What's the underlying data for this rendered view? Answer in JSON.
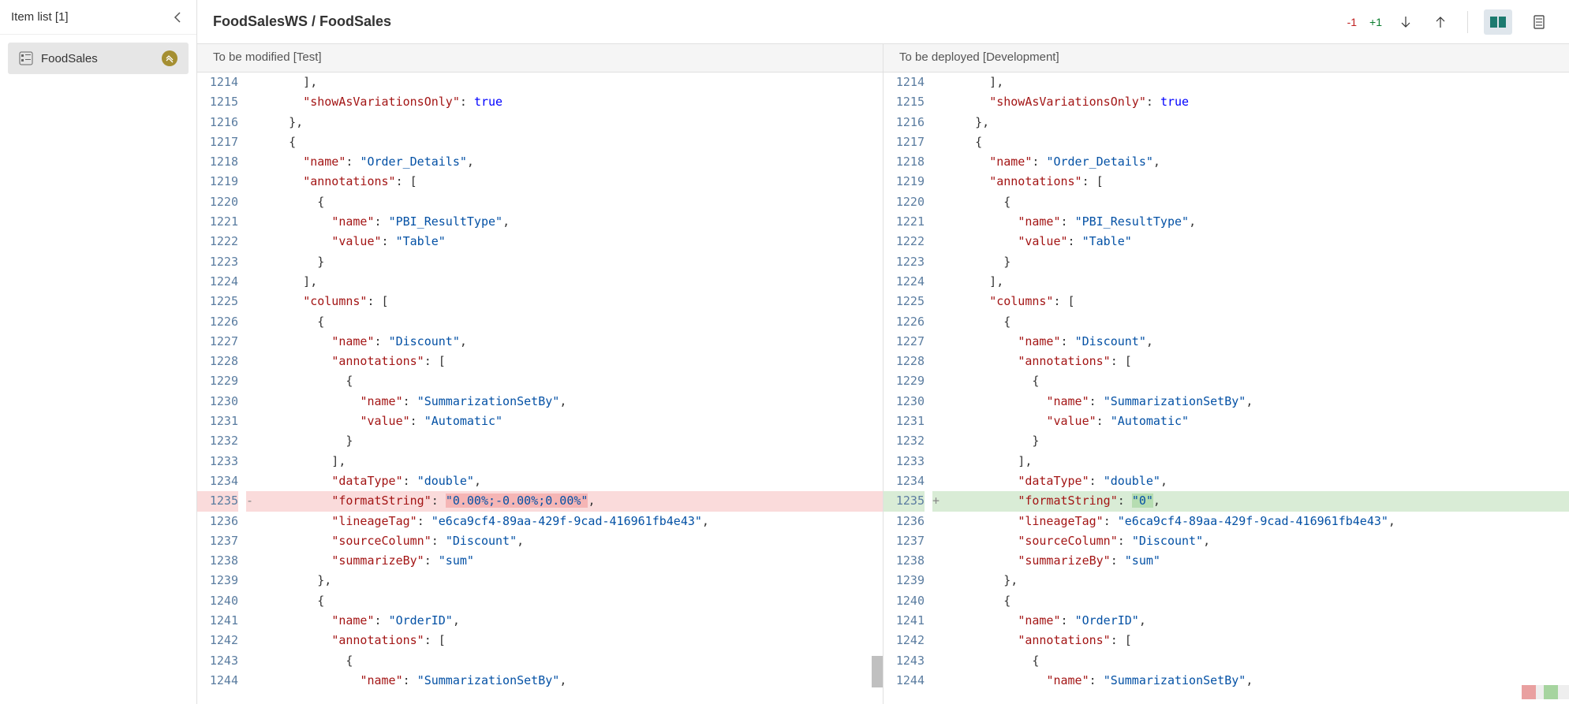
{
  "sidebar": {
    "title": "Item list [1]",
    "item_name": "FoodSales"
  },
  "header": {
    "breadcrumb": "FoodSalesWS / FoodSales",
    "diff_minus": "-1",
    "diff_plus": "+1"
  },
  "panes": {
    "left_title": "To be modified [Test]",
    "right_title": "To be deployed [Development]"
  },
  "code": {
    "left": [
      {
        "n": 1214,
        "t": "punct",
        "txt": "      ],"
      },
      {
        "n": 1215,
        "t": "kv",
        "ind": "      ",
        "key": "showAsVariationsOnly",
        "vtype": "bool",
        "val": "true",
        "comma": false
      },
      {
        "n": 1216,
        "t": "punct",
        "txt": "    },"
      },
      {
        "n": 1217,
        "t": "punct",
        "txt": "    {"
      },
      {
        "n": 1218,
        "t": "kv",
        "ind": "      ",
        "key": "name",
        "vtype": "str",
        "val": "Order_Details",
        "comma": true
      },
      {
        "n": 1219,
        "t": "karr",
        "ind": "      ",
        "key": "annotations"
      },
      {
        "n": 1220,
        "t": "punct",
        "txt": "        {"
      },
      {
        "n": 1221,
        "t": "kv",
        "ind": "          ",
        "key": "name",
        "vtype": "str",
        "val": "PBI_ResultType",
        "comma": true
      },
      {
        "n": 1222,
        "t": "kv",
        "ind": "          ",
        "key": "value",
        "vtype": "str",
        "val": "Table",
        "comma": false
      },
      {
        "n": 1223,
        "t": "punct",
        "txt": "        }"
      },
      {
        "n": 1224,
        "t": "punct",
        "txt": "      ],"
      },
      {
        "n": 1225,
        "t": "karr",
        "ind": "      ",
        "key": "columns"
      },
      {
        "n": 1226,
        "t": "punct",
        "txt": "        {"
      },
      {
        "n": 1227,
        "t": "kv",
        "ind": "          ",
        "key": "name",
        "vtype": "str",
        "val": "Discount",
        "comma": true
      },
      {
        "n": 1228,
        "t": "karr",
        "ind": "          ",
        "key": "annotations"
      },
      {
        "n": 1229,
        "t": "punct",
        "txt": "            {"
      },
      {
        "n": 1230,
        "t": "kv",
        "ind": "              ",
        "key": "name",
        "vtype": "str",
        "val": "SummarizationSetBy",
        "comma": true
      },
      {
        "n": 1231,
        "t": "kv",
        "ind": "              ",
        "key": "value",
        "vtype": "str",
        "val": "Automatic",
        "comma": false
      },
      {
        "n": 1232,
        "t": "punct",
        "txt": "            }"
      },
      {
        "n": 1233,
        "t": "punct",
        "txt": "          ],"
      },
      {
        "n": 1234,
        "t": "kv",
        "ind": "          ",
        "key": "dataType",
        "vtype": "str",
        "val": "double",
        "comma": true
      },
      {
        "n": 1235,
        "t": "kv",
        "ind": "          ",
        "key": "formatString",
        "vtype": "str",
        "val": "0.00%;-0.00%;0.00%",
        "comma": true,
        "diff": "del",
        "mark": "-"
      },
      {
        "n": 1236,
        "t": "kv",
        "ind": "          ",
        "key": "lineageTag",
        "vtype": "str",
        "val": "e6ca9cf4-89aa-429f-9cad-416961fb4e43",
        "comma": true
      },
      {
        "n": 1237,
        "t": "kv",
        "ind": "          ",
        "key": "sourceColumn",
        "vtype": "str",
        "val": "Discount",
        "comma": true
      },
      {
        "n": 1238,
        "t": "kv",
        "ind": "          ",
        "key": "summarizeBy",
        "vtype": "str",
        "val": "sum",
        "comma": false
      },
      {
        "n": 1239,
        "t": "punct",
        "txt": "        },"
      },
      {
        "n": 1240,
        "t": "punct",
        "txt": "        {"
      },
      {
        "n": 1241,
        "t": "kv",
        "ind": "          ",
        "key": "name",
        "vtype": "str",
        "val": "OrderID",
        "comma": true
      },
      {
        "n": 1242,
        "t": "karr",
        "ind": "          ",
        "key": "annotations"
      },
      {
        "n": 1243,
        "t": "punct",
        "txt": "            {"
      },
      {
        "n": 1244,
        "t": "kv",
        "ind": "              ",
        "key": "name",
        "vtype": "str",
        "val": "SummarizationSetBy",
        "comma": true
      }
    ],
    "right": [
      {
        "n": 1214,
        "t": "punct",
        "txt": "      ],"
      },
      {
        "n": 1215,
        "t": "kv",
        "ind": "      ",
        "key": "showAsVariationsOnly",
        "vtype": "bool",
        "val": "true",
        "comma": false
      },
      {
        "n": 1216,
        "t": "punct",
        "txt": "    },"
      },
      {
        "n": 1217,
        "t": "punct",
        "txt": "    {"
      },
      {
        "n": 1218,
        "t": "kv",
        "ind": "      ",
        "key": "name",
        "vtype": "str",
        "val": "Order_Details",
        "comma": true
      },
      {
        "n": 1219,
        "t": "karr",
        "ind": "      ",
        "key": "annotations"
      },
      {
        "n": 1220,
        "t": "punct",
        "txt": "        {"
      },
      {
        "n": 1221,
        "t": "kv",
        "ind": "          ",
        "key": "name",
        "vtype": "str",
        "val": "PBI_ResultType",
        "comma": true
      },
      {
        "n": 1222,
        "t": "kv",
        "ind": "          ",
        "key": "value",
        "vtype": "str",
        "val": "Table",
        "comma": false
      },
      {
        "n": 1223,
        "t": "punct",
        "txt": "        }"
      },
      {
        "n": 1224,
        "t": "punct",
        "txt": "      ],"
      },
      {
        "n": 1225,
        "t": "karr",
        "ind": "      ",
        "key": "columns"
      },
      {
        "n": 1226,
        "t": "punct",
        "txt": "        {"
      },
      {
        "n": 1227,
        "t": "kv",
        "ind": "          ",
        "key": "name",
        "vtype": "str",
        "val": "Discount",
        "comma": true
      },
      {
        "n": 1228,
        "t": "karr",
        "ind": "          ",
        "key": "annotations"
      },
      {
        "n": 1229,
        "t": "punct",
        "txt": "            {"
      },
      {
        "n": 1230,
        "t": "kv",
        "ind": "              ",
        "key": "name",
        "vtype": "str",
        "val": "SummarizationSetBy",
        "comma": true
      },
      {
        "n": 1231,
        "t": "kv",
        "ind": "              ",
        "key": "value",
        "vtype": "str",
        "val": "Automatic",
        "comma": false
      },
      {
        "n": 1232,
        "t": "punct",
        "txt": "            }"
      },
      {
        "n": 1233,
        "t": "punct",
        "txt": "          ],"
      },
      {
        "n": 1234,
        "t": "kv",
        "ind": "          ",
        "key": "dataType",
        "vtype": "str",
        "val": "double",
        "comma": true
      },
      {
        "n": 1235,
        "t": "kv",
        "ind": "          ",
        "key": "formatString",
        "vtype": "str",
        "val": "0",
        "comma": true,
        "diff": "add",
        "mark": "+"
      },
      {
        "n": 1236,
        "t": "kv",
        "ind": "          ",
        "key": "lineageTag",
        "vtype": "str",
        "val": "e6ca9cf4-89aa-429f-9cad-416961fb4e43",
        "comma": true
      },
      {
        "n": 1237,
        "t": "kv",
        "ind": "          ",
        "key": "sourceColumn",
        "vtype": "str",
        "val": "Discount",
        "comma": true
      },
      {
        "n": 1238,
        "t": "kv",
        "ind": "          ",
        "key": "summarizeBy",
        "vtype": "str",
        "val": "sum",
        "comma": false
      },
      {
        "n": 1239,
        "t": "punct",
        "txt": "        },"
      },
      {
        "n": 1240,
        "t": "punct",
        "txt": "        {"
      },
      {
        "n": 1241,
        "t": "kv",
        "ind": "          ",
        "key": "name",
        "vtype": "str",
        "val": "OrderID",
        "comma": true
      },
      {
        "n": 1242,
        "t": "karr",
        "ind": "          ",
        "key": "annotations"
      },
      {
        "n": 1243,
        "t": "punct",
        "txt": "            {"
      },
      {
        "n": 1244,
        "t": "kv",
        "ind": "              ",
        "key": "name",
        "vtype": "str",
        "val": "SummarizationSetBy",
        "comma": true
      }
    ]
  }
}
